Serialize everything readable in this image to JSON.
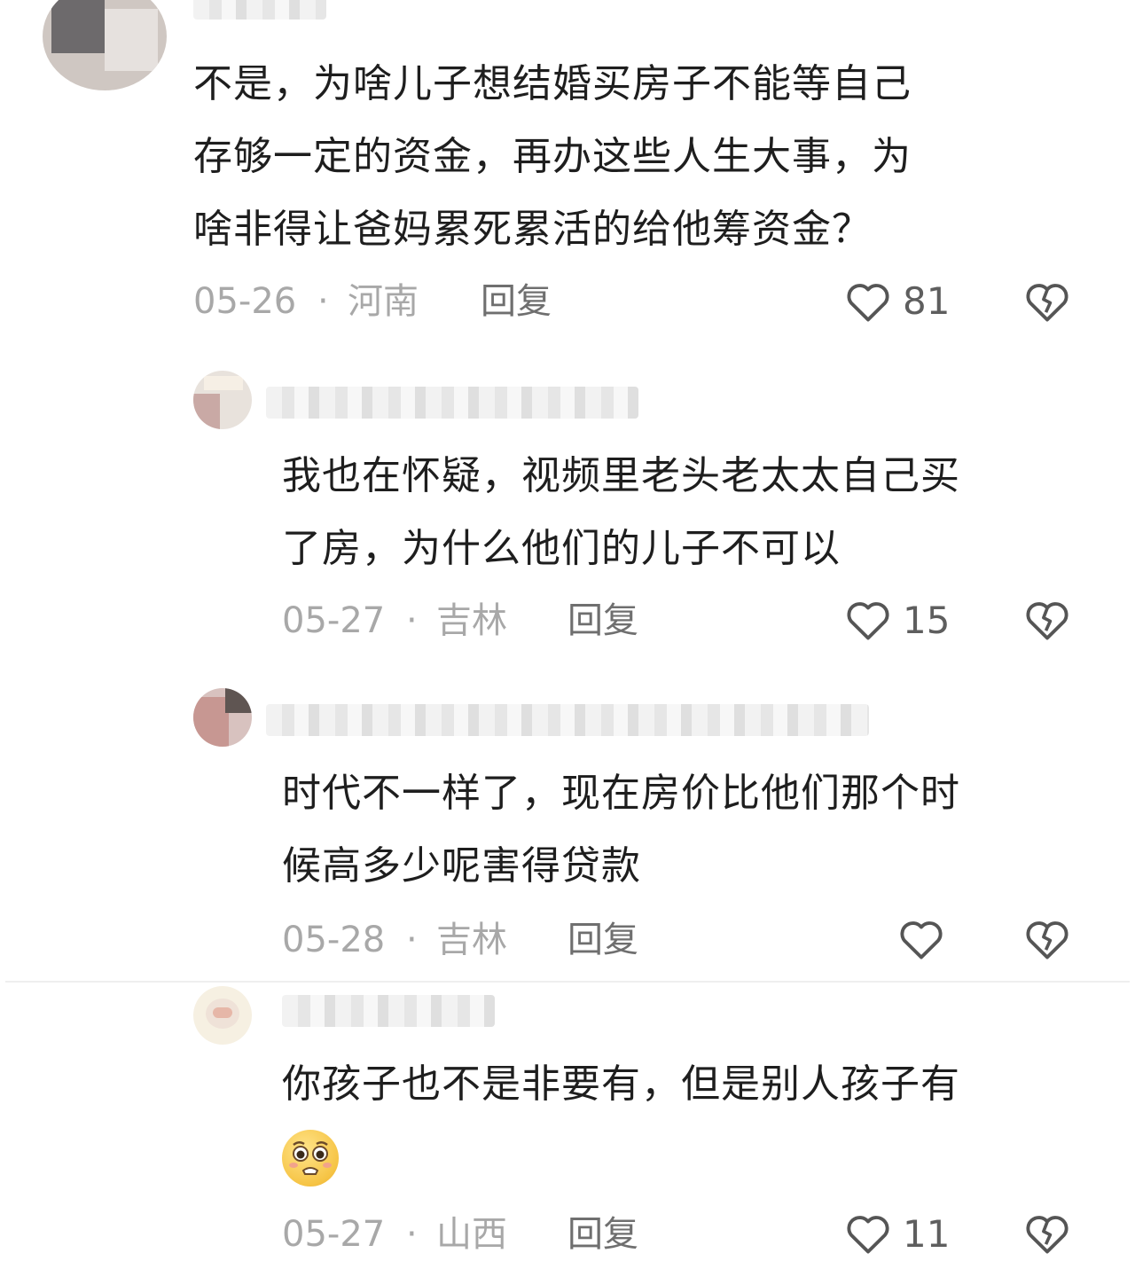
{
  "comments": [
    {
      "text_lines": [
        "不是，为啥儿子想结婚买房子不能等自己",
        "存够一定的资金，再办这些人生大事，为",
        "啥非得让爸妈累死累活的给他筹资金？"
      ],
      "date": "05-26",
      "location": "河南",
      "reply_label": "回复",
      "likes": "81"
    },
    {
      "text_lines": [
        "我也在怀疑，视频里老头老太太自己买",
        "了房，为什么他们的儿子不可以"
      ],
      "date": "05-27",
      "location": "吉林",
      "reply_label": "回复",
      "likes": "15"
    },
    {
      "text_lines": [
        "时代不一样了，现在房价比他们那个时",
        "候高多少呢害得贷款"
      ],
      "date": "05-28",
      "location": "吉林",
      "reply_label": "回复",
      "likes": ""
    },
    {
      "text_lines": [
        "你孩子也不是非要有，但是别人孩子有"
      ],
      "emoji": "crying-pleading-face-emoji",
      "date": "05-27",
      "location": "山西",
      "reply_label": "回复",
      "likes": "11"
    }
  ],
  "separator": "·",
  "icons": {
    "like": "heart-outline-icon",
    "dislike": "broken-heart-icon"
  },
  "colors": {
    "meta_gray": "#a8a8a8",
    "reply_gray": "#6f6f6f",
    "text": "#1e1e1e"
  }
}
